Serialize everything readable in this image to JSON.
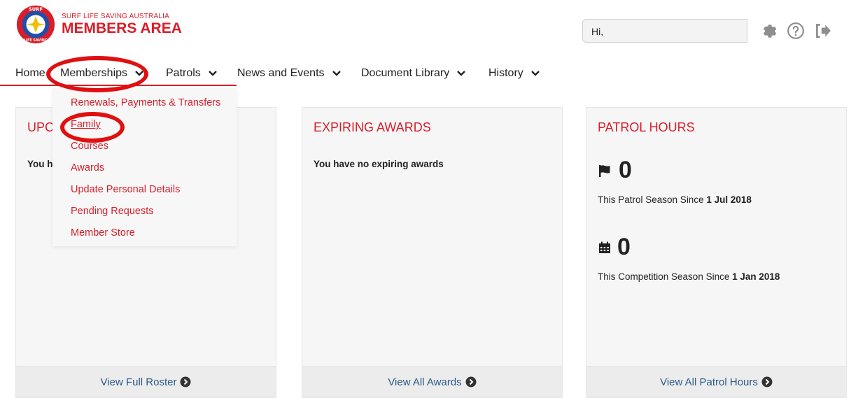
{
  "header": {
    "logo_small": "SURF LIFE SAVING AUSTRALIA",
    "logo_big": "MEMBERS AREA",
    "badge_top": "SURF",
    "badge_bottom": "LIFE SAVING",
    "greeting": "Hi,"
  },
  "nav": {
    "items": [
      {
        "label": "Home"
      },
      {
        "label": "Memberships"
      },
      {
        "label": "Patrols"
      },
      {
        "label": "News and Events"
      },
      {
        "label": "Document Library"
      },
      {
        "label": "History"
      }
    ]
  },
  "dropdown": {
    "items": [
      {
        "label": "Renewals, Payments & Transfers"
      },
      {
        "label": "Family"
      },
      {
        "label": "Courses"
      },
      {
        "label": "Awards"
      },
      {
        "label": "Update Personal Details"
      },
      {
        "label": "Pending Requests"
      },
      {
        "label": "Member Store"
      }
    ]
  },
  "cards": {
    "upcoming": {
      "title": "UPC",
      "message": "You h",
      "link": "View Full Roster"
    },
    "awards": {
      "title": "EXPIRING AWARDS",
      "message": "You have no expiring awards",
      "link": "View All Awards"
    },
    "patrol": {
      "title": "PATROL HOURS",
      "patrol_value": "0",
      "patrol_text": "This Patrol Season Since ",
      "patrol_date": "1 Jul 2018",
      "comp_value": "0",
      "comp_text": "This Competition Season Since ",
      "comp_date": "1 Jan 2018",
      "link": "View All Patrol Hours"
    }
  },
  "colors": {
    "brand_red": "#d81e2a",
    "link_blue": "#2a5a8a",
    "annotation_red": "#e01010"
  }
}
